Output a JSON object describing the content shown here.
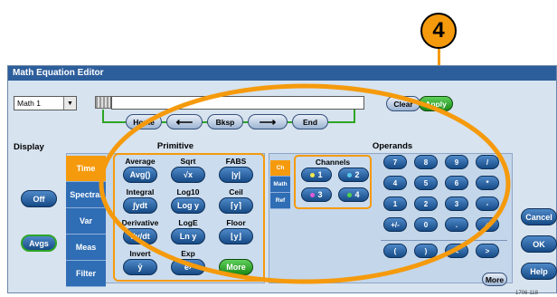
{
  "callout": {
    "number": "4"
  },
  "window": {
    "title": "Math Equation Editor"
  },
  "equation": {
    "source_select": "Math 1",
    "value": "",
    "clear_label": "Clear",
    "apply_label": "Apply"
  },
  "nav": {
    "home_label": "Home",
    "bksp_label": "Bksp",
    "end_label": "End"
  },
  "display": {
    "title": "Display",
    "off_label": "Off",
    "avgs_label": "Avgs"
  },
  "primitive": {
    "title": "Primitive",
    "tabs": [
      "Time",
      "Spectral",
      "Var",
      "Meas",
      "Filter"
    ],
    "cells": [
      {
        "label": "Average",
        "button": "Avg()"
      },
      {
        "label": "Sqrt",
        "button": "√x"
      },
      {
        "label": "FABS",
        "button": "|y|"
      },
      {
        "label": "Integral",
        "button": "∫ydt"
      },
      {
        "label": "Log10",
        "button": "Log y"
      },
      {
        "label": "Ceil",
        "button": "⌈y⌉"
      },
      {
        "label": "Derivative",
        "button": "dy/dt"
      },
      {
        "label": "LogE",
        "button": "Ln y"
      },
      {
        "label": "Floor",
        "button": "⌊y⌋"
      },
      {
        "label": "Invert",
        "button": "ȳ"
      },
      {
        "label": "Exp",
        "button": "eʸ"
      },
      {
        "label": "",
        "button": "More"
      }
    ]
  },
  "operands": {
    "title": "Operands",
    "channels_title": "Channels",
    "tabs": [
      "Ch",
      "Math",
      "Ref"
    ],
    "channels": [
      "1",
      "2",
      "3",
      "4"
    ],
    "keys": [
      [
        "7",
        "8",
        "9",
        "/"
      ],
      [
        "4",
        "5",
        "6",
        "*"
      ],
      [
        "1",
        "2",
        "3",
        "-"
      ],
      [
        "+/-",
        "0",
        ".",
        "+"
      ],
      [
        "(",
        ")",
        "<",
        ">"
      ]
    ],
    "more_label": "More"
  },
  "side": {
    "cancel_label": "Cancel",
    "ok_label": "OK",
    "help_label": "Help"
  },
  "footer": {
    "code": "1706-118"
  },
  "colors": {
    "accent_orange": "#f59a0c",
    "title_blue": "#2d5e9c",
    "tab_orange": "#f59a0c",
    "tab_blue": "#2f6db5",
    "apply_green": "#2da524"
  }
}
